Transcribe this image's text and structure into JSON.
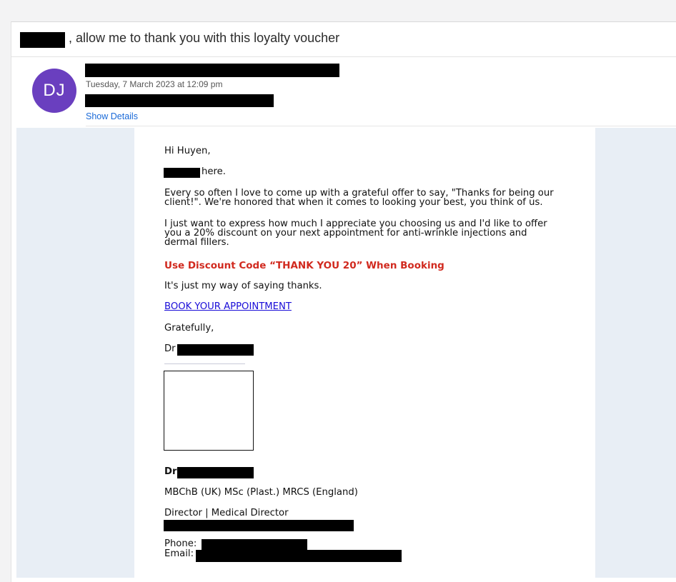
{
  "subject": {
    "text": ", allow me to thank you with this loyalty voucher"
  },
  "sender": {
    "avatar_initials": "DJ",
    "avatar_color": "#6a3fbf",
    "date": "Tuesday, 7 March 2023 at 12:09 pm",
    "show_details": "Show Details"
  },
  "email_body": {
    "greeting": "Hi Huyen,",
    "intro_suffix": "here.",
    "paragraph1_line1": "Every so often I love to come up with a grateful offer to say, \"Thanks for being our",
    "paragraph1_line2": "client!\". We're honored that when it comes to looking your best, you think of us.",
    "paragraph2_line1": "I just want to express how much I appreciate you choosing us and I'd like to offer",
    "paragraph2_line2": "you a 20% discount on your next appointment for anti-wrinkle injections and",
    "paragraph2_line3": "dermal fillers.",
    "promo_code": "Use Discount Code “THANK YOU 20” When Booking",
    "thanks_line": "It's just my way of saying thanks.",
    "book_link": "BOOK YOUR APPOINTMENT",
    "sign_off": "Gratefully,",
    "signer_prefix": "Dr"
  },
  "signature": {
    "name_prefix": "Dr",
    "credentials": "MBChB (UK) MSc (Plast.) MRCS (England)",
    "title": "Director | Medical Director",
    "phone_label": "Phone:",
    "email_label": "Email:"
  },
  "colors": {
    "promo_red": "#d12a1f",
    "link_blue": "#1a0dd8",
    "show_details_blue": "#1a6ad8",
    "canvas_blue": "#e8eef5"
  }
}
